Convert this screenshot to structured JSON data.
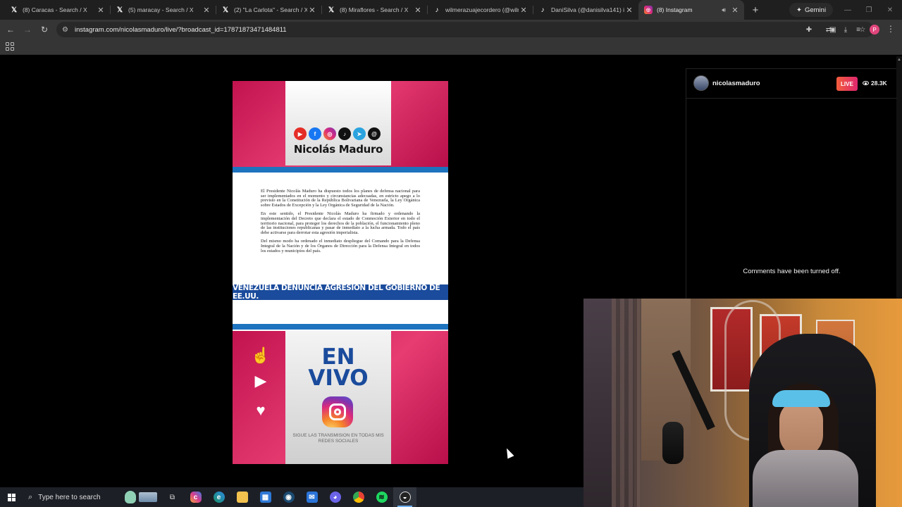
{
  "browser": {
    "tabs": [
      {
        "title": "(8) Caracas - Search / X",
        "favicon": "x-icon",
        "active": false
      },
      {
        "title": "(5) maracay - Search / X",
        "favicon": "x-icon",
        "active": false
      },
      {
        "title": "(2) \"La Carlota\" - Search / X",
        "favicon": "x-icon",
        "active": false
      },
      {
        "title": "(8) Miraflores - Search / X",
        "favicon": "x-icon",
        "active": false
      },
      {
        "title": "wilmerazuajecordero (@wilm",
        "favicon": "tiktok-icon",
        "active": false
      },
      {
        "title": "DaniSilva (@danisilva141) is l",
        "favicon": "tiktok-icon",
        "active": false
      },
      {
        "title": "(8) Instagram",
        "favicon": "instagram-icon",
        "active": true
      }
    ],
    "gemini_label": "Gemini",
    "url": "instagram.com/nicolasmaduro/live/?broadcast_id=17871873471484811",
    "profile_initial": "P"
  },
  "video": {
    "brand_name": "Nicolás Maduro",
    "doc_paragraphs": [
      "El Presidente Nicolás Maduro ha dispuesto todos los planes de defensa nacional para ser implementados en el momento y circunstancias adecuadas, en estricto apego a lo previsto en la Constitución de la República Bolivariana de Venezuela, la Ley Orgánica sobre Estados de Excepción y la Ley Orgánica de Seguridad de la Nación.",
      "En este sentido, el Presidente Nicolás Maduro ha firmado y ordenando la implementación del Decreto que declara el estado de Conmoción Exterior en todo el territorio nacional, para proteger los derechos de la población, el funcionamiento pleno de las instituciones republicanas y pasar de inmediato a la lucha armada. Todo el país debe activarse para derrotar esta agresión imperialista.",
      "Del mismo modo ha ordenado el inmediato despliegue del Comando para la Defensa Integral de la Nación y de los Órganos de Dirección para la Defensa Integral en todos los estados y municipios del país."
    ],
    "banner": "VENEZUELA DENUNCIA AGRESIÓN DEL GOBIERNO DE EE.UU.",
    "envivo_line1": "EN",
    "envivo_line2": "VIVO",
    "sigue": "SIGUE LAS TRANSMISION EN TODAS MIS REDES SOCIALES"
  },
  "live_panel": {
    "username": "nicolasmaduro",
    "live_badge": "LIVE",
    "viewer_count": "28.3K",
    "comments_status": "Comments have been turned off."
  },
  "taskbar": {
    "search_placeholder": "Type here to search"
  },
  "colors": {
    "magenta": "#d81f5f",
    "banner_blue": "#1a4b9c",
    "stripe_blue": "#1e73be"
  }
}
